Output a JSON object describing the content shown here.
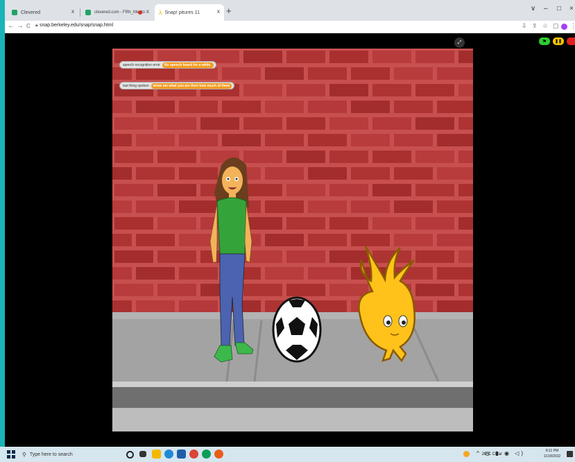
{
  "browser": {
    "tabs": [
      {
        "title": "Clevered",
        "favicon_color": "#21a366",
        "close": "x"
      },
      {
        "title": "clevered.com - Fifth_Mento:",
        "favicon_color": "#21a366",
        "close": "x",
        "record_dot": true
      },
      {
        "title": "Snap! pitures 11",
        "favicon_color": "#f4b400",
        "close": "x"
      }
    ],
    "new_tab": "+",
    "window_controls": [
      "∨",
      "–",
      "□",
      "×"
    ],
    "nav": {
      "back": "←",
      "forward": "→",
      "reload": "C"
    },
    "url": "snap.berkeley.edu/snap/snap.html"
  },
  "snap": {
    "controls": [
      {
        "name": "green-flag",
        "symbol": "⚑",
        "color": "#2ecc2e"
      },
      {
        "name": "pause",
        "symbol": "❚❚",
        "color": "#f5c400"
      },
      {
        "name": "stop",
        "symbol": "■",
        "color": "#e02020"
      }
    ],
    "watchers": [
      {
        "label": "speech recognition error",
        "value": "No speech heard for a while."
      },
      {
        "label": "last thing spoken",
        "value": "show me what you are then how much of them"
      }
    ],
    "colors": {
      "brick": "#b5383a",
      "mortar": "#c95b5a",
      "sidewalk": "#8f8f8f",
      "watcher_value": "#f39c1f"
    }
  },
  "taskbar": {
    "search_placeholder": "Type here to search",
    "weather": "26°C  Clear",
    "time": "8:11 PM",
    "date": "11/18/2022"
  }
}
